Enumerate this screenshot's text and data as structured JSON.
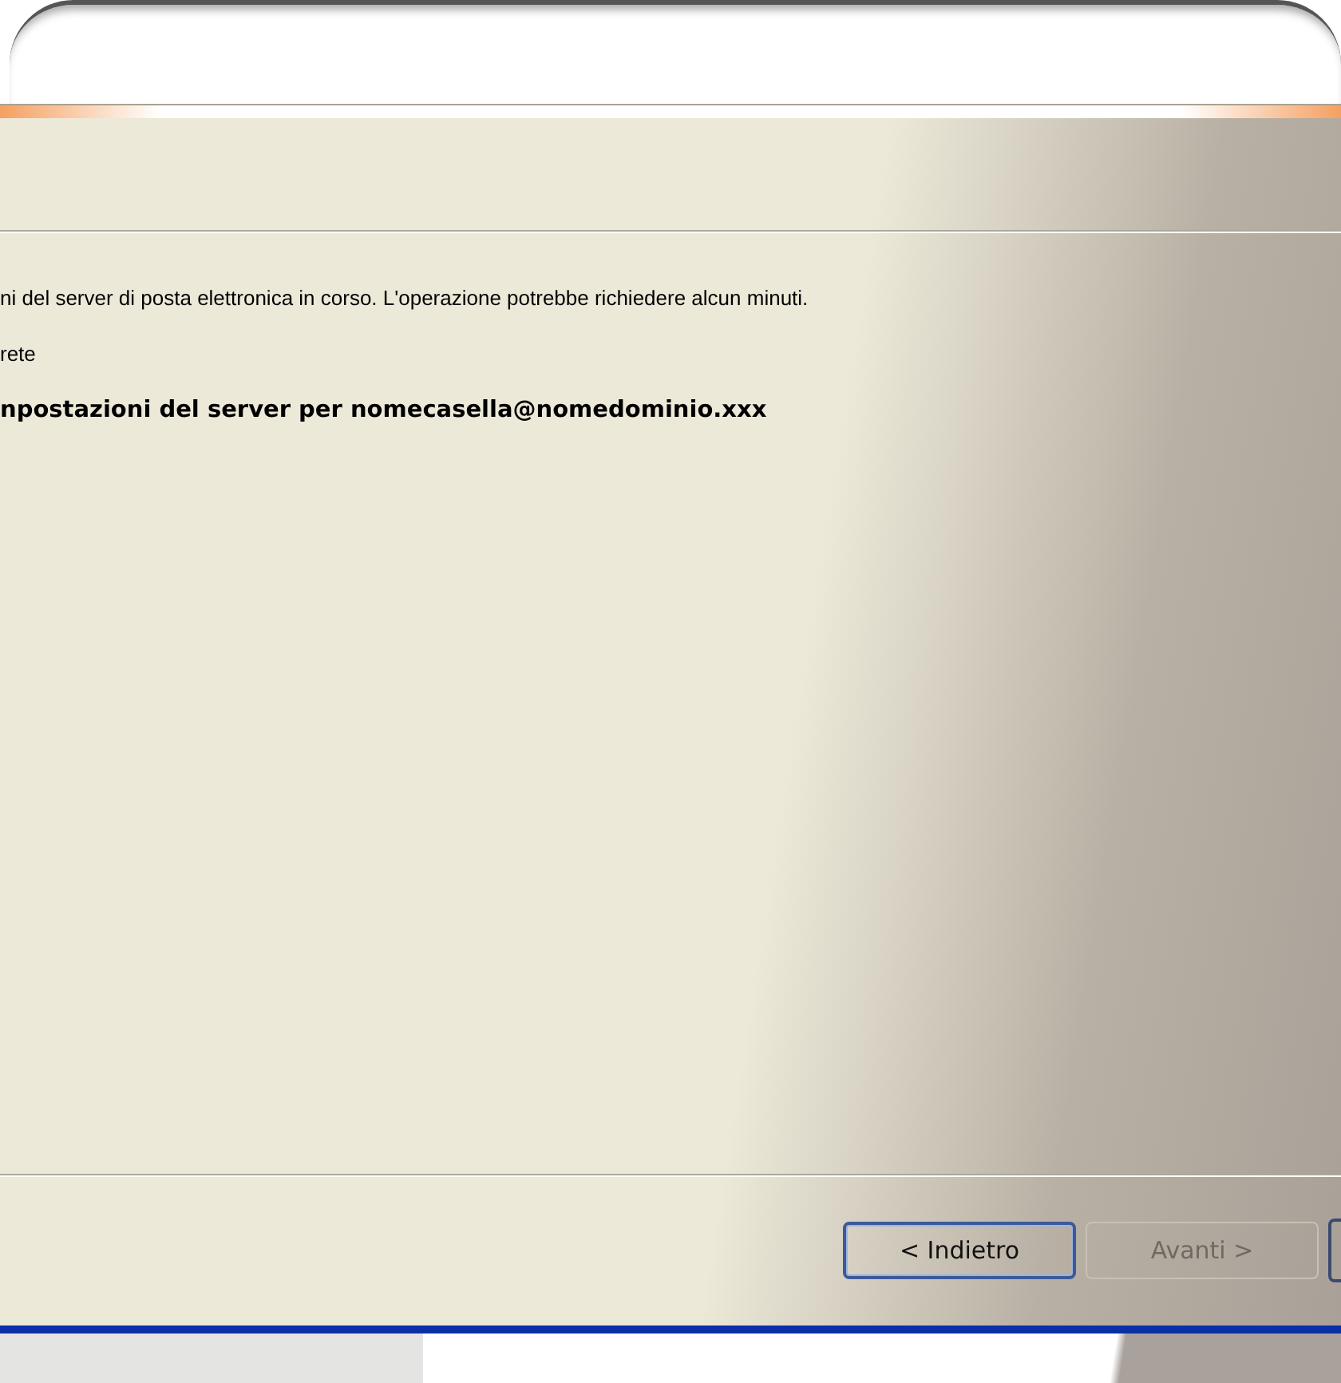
{
  "status_lines": [
    {
      "text": "ni del server di posta elettronica in corso. L'operazione potrebbe richiedere alcun minuti.",
      "bold": false
    },
    {
      "text": "rete",
      "bold": false
    },
    {
      "text": "npostazioni del server per nomecasella@nomedominio.xxx",
      "bold": true
    }
  ],
  "buttons": [
    {
      "label": "< Indietro",
      "disabled": false,
      "default": true
    },
    {
      "label": "Avanti >",
      "disabled": true,
      "default": false
    }
  ]
}
